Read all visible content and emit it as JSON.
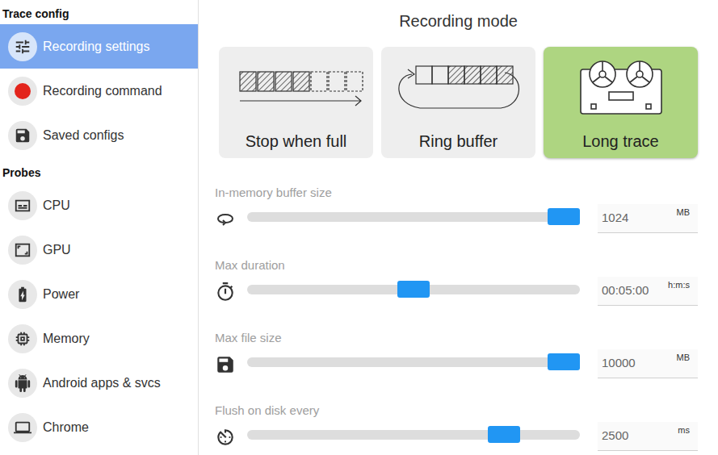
{
  "sidebar": {
    "sections": [
      {
        "header": "Trace config",
        "items": [
          {
            "label": "Recording settings",
            "selected": true
          },
          {
            "label": "Recording command",
            "selected": false
          },
          {
            "label": "Saved configs",
            "selected": false
          }
        ]
      },
      {
        "header": "Probes",
        "items": [
          {
            "label": "CPU",
            "selected": false
          },
          {
            "label": "GPU",
            "selected": false
          },
          {
            "label": "Power",
            "selected": false
          },
          {
            "label": "Memory",
            "selected": false
          },
          {
            "label": "Android apps & svcs",
            "selected": false
          },
          {
            "label": "Chrome",
            "selected": false
          }
        ]
      }
    ]
  },
  "title": "Recording mode",
  "modes": [
    {
      "label": "Stop when full",
      "selected": false
    },
    {
      "label": "Ring buffer",
      "selected": false
    },
    {
      "label": "Long trace",
      "selected": true
    }
  ],
  "sliders": [
    {
      "label": "In-memory buffer size",
      "level": 1.0,
      "value": "1024",
      "unit": "MB"
    },
    {
      "label": "Max duration",
      "level": 0.5,
      "value": "00:05:00",
      "unit": "h:m:s"
    },
    {
      "label": "Max file size",
      "level": 1.0,
      "value": "10000",
      "unit": "MB"
    },
    {
      "label": "Flush on disk every",
      "level": 0.8,
      "value": "2500",
      "unit": "ms"
    }
  ]
}
